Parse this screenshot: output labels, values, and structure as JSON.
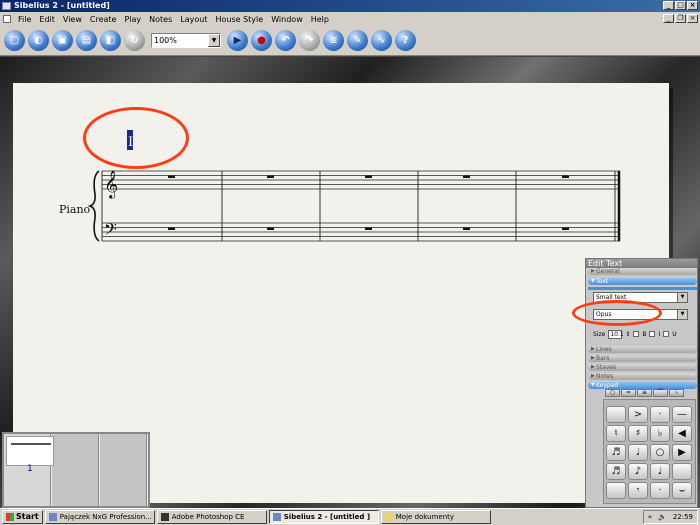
{
  "window": {
    "title": "Sibelius 2 - [untitled]"
  },
  "menu": [
    "File",
    "Edit",
    "View",
    "Create",
    "Play",
    "Notes",
    "Layout",
    "House Style",
    "Window",
    "Help"
  ],
  "toolbar": {
    "zoom": "100%",
    "icons": [
      "new-icon",
      "open-icon",
      "save-icon",
      "print-icon",
      "parts-icon",
      "undo-history-icon",
      "play-icon",
      "stop-record-icon",
      "undo-icon",
      "redo-icon",
      "mixer-icon",
      "plug-in-icon",
      "ideas-icon",
      "help-icon"
    ]
  },
  "score": {
    "instrument": "Piano",
    "cursor": "I"
  },
  "edit_text": {
    "title": "Edit Text",
    "sections": [
      "General",
      "Text",
      "Lines",
      "Bars",
      "Staves",
      "Notes",
      "Keypad"
    ],
    "style": "Small text",
    "font": "Opus",
    "size_label": "Size",
    "size": "10.1",
    "bold": "B",
    "italic": "I",
    "underline": "U"
  },
  "keypad": {
    "tabs": [
      "1",
      "2",
      "3",
      "4",
      "5"
    ],
    "keys": [
      "",
      "",
      "",
      "",
      "—",
      "&gt;",
      "·",
      "",
      "♮",
      "♯",
      "♭",
      "◀◀",
      "♬",
      "♩",
      "𝅗𝅥",
      "▶",
      "♪♪",
      "♪",
      "𝅗𝅥.",
      "",
      "",
      "𝄽",
      "·",
      ""
    ]
  },
  "navigator": {
    "page_label": "1"
  },
  "taskbar": {
    "start": "Start",
    "tasks": [
      "Pajączek NxG Profession...",
      "Adobe Photoshop CE",
      "Sibelius 2 - [untitled ]",
      "Moje dokumenty"
    ],
    "clock": "22:59",
    "tray_arrow": "«"
  },
  "colors": {
    "titlebar": "#0a246a",
    "annotation": "#ff3c12",
    "panel_active": "#4c8fd8"
  }
}
